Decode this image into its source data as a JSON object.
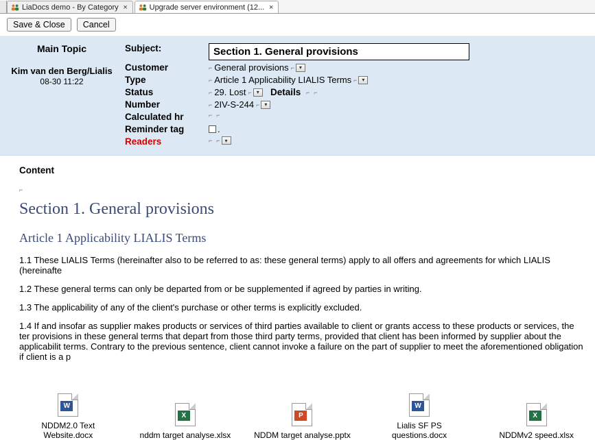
{
  "tabs": [
    {
      "label": "LiaDocs demo - By Category"
    },
    {
      "label": "Upgrade server environment (12..."
    }
  ],
  "toolbar": {
    "save_close": "Save & Close",
    "cancel": "Cancel"
  },
  "form": {
    "main_topic_label": "Main Topic",
    "author": "Kim van den Berg/Lialis",
    "timestamp": "08-30 11:22",
    "labels": {
      "subject": "Subject:",
      "customer": "Customer",
      "type": "Type",
      "status": "Status",
      "details": "Details",
      "number": "Number",
      "calc_hr": "Calculated hr",
      "reminder": "Reminder tag",
      "readers": "Readers"
    },
    "values": {
      "subject": "Section 1. General provisions",
      "customer": "General provisions",
      "type": "Article 1 Applicability LIALIS Terms",
      "status": "29. Lost",
      "details": "",
      "number": "2IV-S-244",
      "calc_hr": "",
      "reminder": ".",
      "readers": ""
    }
  },
  "content": {
    "content_label": "Content",
    "h1": "Section 1. General provisions",
    "h2": "Article 1 Applicability LIALIS Terms",
    "p1": "1.1 These LIALIS Terms (hereinafter also to be referred to as: these general terms) apply to all offers and agreements for which LIALIS (hereinafte",
    "p2": "1.2 These general terms can only be departed from or be supplemented if agreed by parties in writing.",
    "p3": "1.3 The applicability of any of the client's purchase or other terms is explicitly excluded.",
    "p4": "1.4 If and insofar as supplier makes products or services of third parties available to client or grants access to these products or services, the ter provisions in these general terms that depart from those third party terms, provided that client has been informed by supplier about the applicabilit terms. Contrary to the previous sentence, client cannot invoke a failure on the part of supplier to meet the aforementioned obligation if client is a p"
  },
  "attachments": [
    {
      "name": "NDDM2.0 Text Website.docx",
      "kind": "w",
      "glyph": "W"
    },
    {
      "name": "nddm target analyse.xlsx",
      "kind": "x",
      "glyph": "X"
    },
    {
      "name": "NDDM target analyse.pptx",
      "kind": "p",
      "glyph": "P"
    },
    {
      "name": "Lialis SF PS questions.docx",
      "kind": "w",
      "glyph": "W"
    },
    {
      "name": "NDDMv2 speed.xlsx",
      "kind": "x",
      "glyph": "X"
    }
  ]
}
